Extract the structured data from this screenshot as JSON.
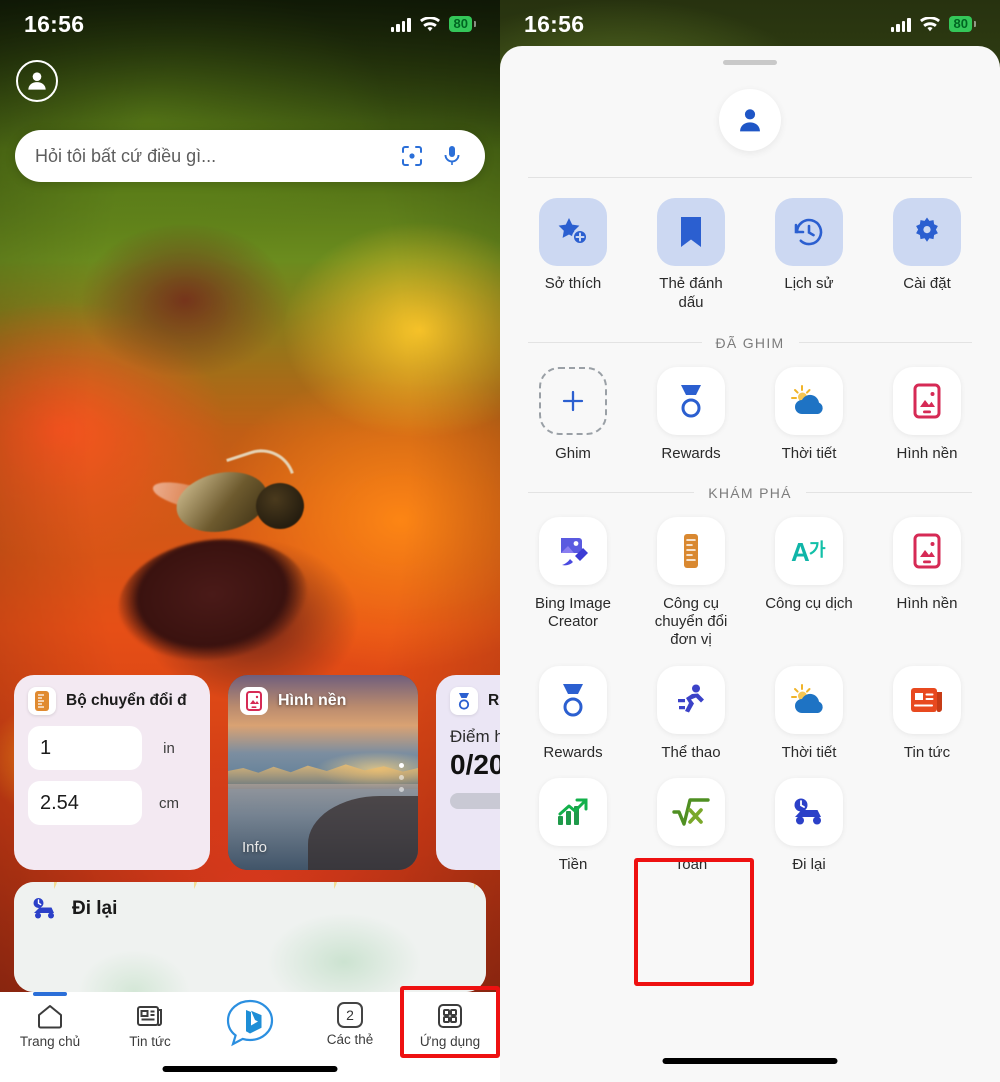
{
  "status_bar": {
    "time": "16:56",
    "battery": "80",
    "signal_icon": "cellular-bars-icon",
    "wifi_icon": "wifi-icon",
    "battery_icon": "battery-charging-icon"
  },
  "left_screen": {
    "avatar_icon": "account-avatar-icon",
    "search": {
      "placeholder": "Hỏi tôi bất cứ điều gì...",
      "camera_icon": "visual-search-camera-icon",
      "mic_icon": "microphone-icon"
    },
    "widgets": {
      "converter": {
        "icon": "unit-converter-icon",
        "title": "Bộ chuyển đổi đ",
        "value_from": "1",
        "unit_from": "in",
        "value_to": "2.54",
        "unit_to": "cm"
      },
      "wallpaper": {
        "icon": "wallpaper-icon",
        "title": "Hình nền",
        "info_label": "Info"
      },
      "rewards": {
        "icon": "rewards-medal-icon",
        "title": "R",
        "subtitle": "Điểm h",
        "score": "0/20"
      },
      "travel": {
        "icon": "travel-car-icon",
        "title": "Đi lại"
      }
    },
    "tabbar": [
      {
        "label": "Trang chủ",
        "icon": "home-icon",
        "active": true
      },
      {
        "label": "Tin tức",
        "icon": "news-icon",
        "active": false
      },
      {
        "label": "",
        "icon": "bing-chat-icon",
        "active": false
      },
      {
        "label": "Các thẻ",
        "icon": "tabs-count-icon",
        "badge": "2",
        "active": false
      },
      {
        "label": "Ứng dụng",
        "icon": "apps-grid-icon",
        "active": false,
        "highlighted": true
      }
    ]
  },
  "right_screen": {
    "avatar_icon": "account-avatar-icon",
    "quick_actions": [
      {
        "label": "Sở thích",
        "icon": "star-add-icon"
      },
      {
        "label": "Thẻ đánh dấu",
        "icon": "bookmark-icon"
      },
      {
        "label": "Lịch sử",
        "icon": "history-clock-icon"
      },
      {
        "label": "Cài đặt",
        "icon": "gear-settings-icon"
      }
    ],
    "sections": [
      {
        "title": "ĐÃ GHIM",
        "apps": [
          {
            "label": "Ghim",
            "icon": "plus-pin-icon",
            "style": "dashed"
          },
          {
            "label": "Rewards",
            "icon": "rewards-medal-icon"
          },
          {
            "label": "Thời tiết",
            "icon": "weather-cloud-sun-icon"
          },
          {
            "label": "Hình nền",
            "icon": "wallpaper-icon"
          }
        ]
      },
      {
        "title": "KHÁM PHÁ",
        "apps": [
          {
            "label": "Bing Image Creator",
            "icon": "image-creator-icon"
          },
          {
            "label": "Công cụ chuyển đổi đơn vị",
            "icon": "unit-converter-icon"
          },
          {
            "label": "Công cụ dịch",
            "icon": "translate-icon"
          },
          {
            "label": "Hình nền",
            "icon": "wallpaper-icon"
          },
          {
            "label": "Rewards",
            "icon": "rewards-medal-icon"
          },
          {
            "label": "Thể thao",
            "icon": "sports-runner-icon"
          },
          {
            "label": "Thời tiết",
            "icon": "weather-cloud-sun-icon"
          },
          {
            "label": "Tin tức",
            "icon": "news-icon"
          },
          {
            "label": "Tiền",
            "icon": "finance-chart-icon"
          },
          {
            "label": "Toán",
            "icon": "math-sqrt-icon",
            "highlighted": true
          },
          {
            "label": "Đi lại",
            "icon": "travel-car-icon"
          }
        ]
      }
    ]
  },
  "colors": {
    "highlight": "#ee1111",
    "accent_blue": "#2b6fd8",
    "quick_tile": "#ccd8f2",
    "battery_green": "#34c759"
  }
}
